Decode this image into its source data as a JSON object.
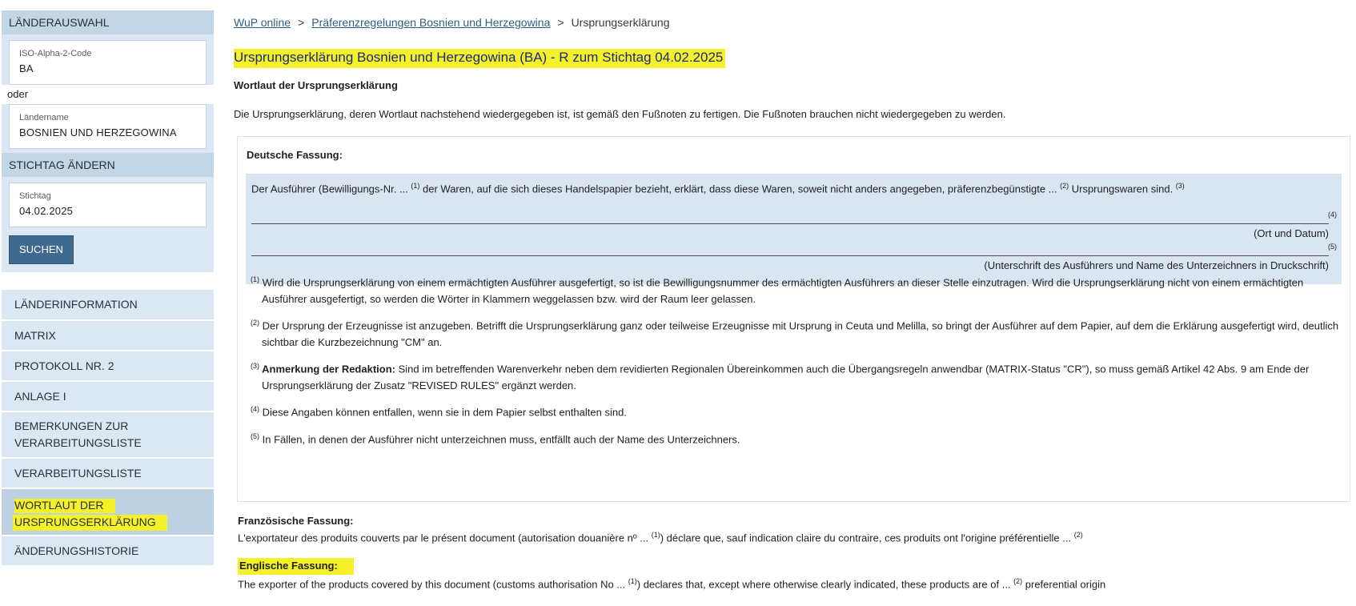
{
  "sidebar": {
    "country_section_title": "LÄNDERAUSWAHL",
    "iso_label": "ISO-Alpha-2-Code",
    "iso_value": "BA",
    "or_text": "oder",
    "country_name_label": "Ländername",
    "country_name_value": "BOSNIEN UND HERZEGOWINA",
    "date_section_title": "STICHTAG ÄNDERN",
    "date_label": "Stichtag",
    "date_value": "04.02.2025",
    "search_button": "SUCHEN",
    "nav": [
      {
        "label": "LÄNDERINFORMATION"
      },
      {
        "label": "MATRIX"
      },
      {
        "label": "PROTOKOLL NR. 2"
      },
      {
        "label": "ANLAGE I"
      },
      {
        "label": "BEMERKUNGEN ZUR VERARBEITUNGSLISTE"
      },
      {
        "label": "VERARBEITUNGSLISTE"
      },
      {
        "label_line1": "WORTLAUT DER",
        "label_line2": "URSPRUNGSERKLÄRUNG"
      },
      {
        "label": "ÄNDERUNGSHISTORIE"
      }
    ]
  },
  "breadcrumb": {
    "home": "WuP online",
    "sep": ">",
    "parent": "Präferenzregelungen Bosnien und Herzegowina",
    "current": "Ursprungserklärung"
  },
  "main": {
    "title": "Ursprungserklärung Bosnien und Herzegowina (BA) - R zum Stichtag 04.02.2025",
    "subheading": "Wortlaut der Ursprungserklärung",
    "intro": "Die Ursprungserklärung, deren Wortlaut nachstehend wiedergegeben ist, ist gemäß den Fußnoten zu fertigen. Die Fußnoten brauchen nicht wiedergegeben zu werden."
  },
  "german": {
    "heading": "Deutsche Fassung:",
    "decl_part1": "Der Ausführer (Bewilligungs-Nr. ... ",
    "sup1": "(1)",
    "decl_part2": " der Waren, auf die sich dieses Handelspapier bezieht, erklärt, dass diese Waren, soweit nicht anders angegeben, präferenzbegünstigte ... ",
    "sup2": "(2)",
    "decl_part3": " Ursprungswaren sind. ",
    "sup3": "(3)",
    "mark4": "(4)",
    "place_date": "(Ort und Datum)",
    "mark5": "(5)",
    "signature": "(Unterschrift des Ausführers und Name des Unterzeichners in Druckschrift)"
  },
  "footnotes": [
    {
      "mark": "(1)",
      "text": " Wird die Ursprungserklärung von einem ermächtigten Ausführer ausgefertigt, so ist die Bewilligungsnummer des ermächtigten Ausführers an dieser Stelle einzutragen. Wird die Ursprungserklärung nicht von einem ermächtigten Ausführer ausgefertigt, so werden die Wörter in Klammern weggelassen bzw. wird der Raum leer gelassen."
    },
    {
      "mark": "(2)",
      "text": " Der Ursprung der Erzeugnisse ist anzugeben. Betrifft die Ursprungserklärung ganz oder teilweise Erzeugnisse mit Ursprung in Ceuta und Melilla, so bringt der Ausführer auf dem Papier, auf dem die Erklärung ausgefertigt wird, deutlich sichtbar die Kurzbezeichnung \"CM\" an."
    },
    {
      "mark": "(3)",
      "bold": " Anmerkung der Redaktion:",
      "text": " Sind im betreffenden Warenverkehr neben dem revidierten Regionalen Übereinkommen auch die Übergangsregeln anwendbar (MATRIX-Status \"CR\"), so muss gemäß Artikel 42 Abs. 9 am Ende der Ursprungserklärung der Zusatz \"REVISED RULES\" ergänzt werden."
    },
    {
      "mark": "(4)",
      "text": " Diese Angaben können entfallen, wenn sie in dem Papier selbst enthalten sind."
    },
    {
      "mark": "(5)",
      "text": " In Fällen, in denen der Ausführer nicht unterzeichnen muss, entfällt auch der Name des Unterzeichners."
    }
  ],
  "french": {
    "heading": "Französische Fassung:",
    "part1": "L'exportateur des produits couverts par le présent document (autorisation douanière nº ... ",
    "sup1": "(1)",
    "part2": ") déclare que, sauf indication claire du contraire, ces produits ont l'origine préférentielle ... ",
    "sup2": "(2)"
  },
  "english": {
    "heading": "Englische Fassung:",
    "part1": "The exporter of the products covered by this document (customs authorisation No ... ",
    "sup1": "(1)",
    "part2": ") declares that, except where otherwise clearly indicated, these products are of ... ",
    "sup2": "(2)",
    "part3": " preferential origin"
  },
  "colors": {
    "highlight": "#f4f02a",
    "panel": "#dbe7f3",
    "panel_head": "#c3d6e6",
    "button": "#3f6a8e",
    "link": "#2d5d86"
  }
}
